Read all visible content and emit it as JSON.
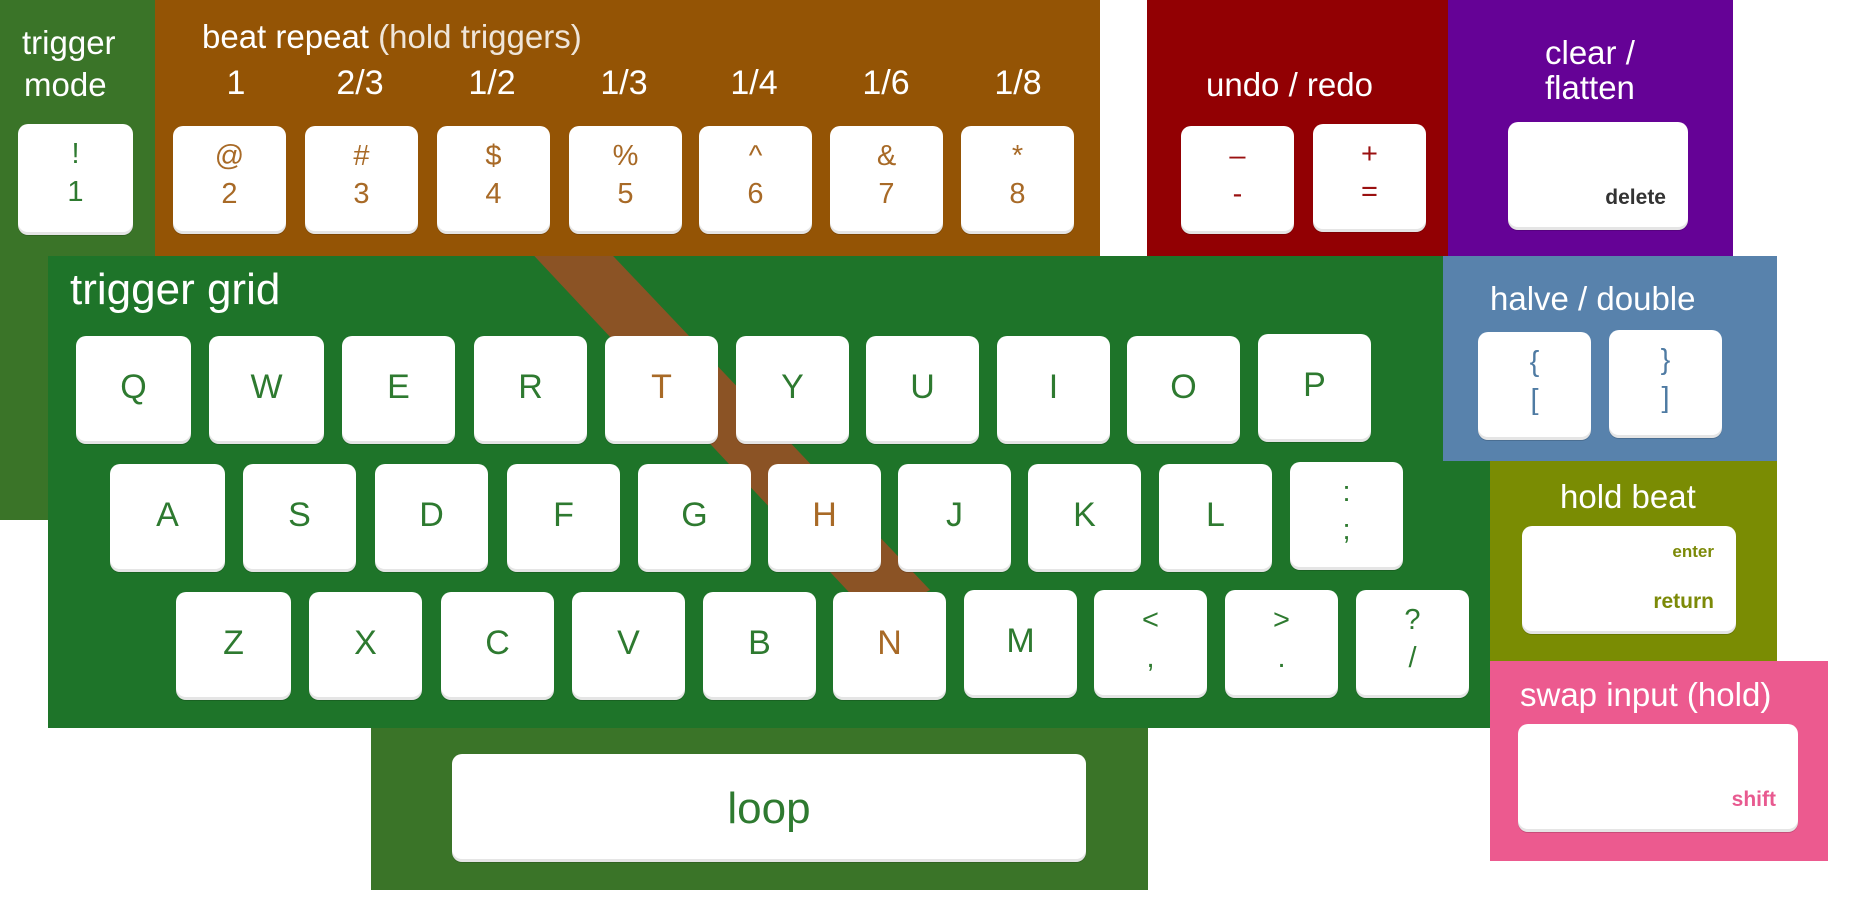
{
  "colors": {
    "trigger_grid_green": "#1e7429",
    "trigger_mode_green": "#3a7428",
    "beat_repeat_brown": "#945405",
    "diagonal_brown": "#8b5325",
    "undo_red": "#920003",
    "clear_purple": "#650296",
    "halve_blue": "#5882ac",
    "hold_beat_olive": "#7a8c03",
    "swap_pink": "#ec5a8f",
    "loop_green": "#3a7428",
    "key_white": "#ffffff"
  },
  "trigger_mode": {
    "title_line1": "trigger",
    "title_line2": "mode",
    "key": {
      "top": "!",
      "bottom": "1"
    }
  },
  "beat_repeat": {
    "title": "beat repeat",
    "subtitle": "(hold triggers)",
    "fractions": [
      "1",
      "2/3",
      "1/2",
      "1/3",
      "1/4",
      "1/6",
      "1/8"
    ],
    "keys": [
      {
        "top": "@",
        "bottom": "2"
      },
      {
        "top": "#",
        "bottom": "3"
      },
      {
        "top": "$",
        "bottom": "4"
      },
      {
        "top": "%",
        "bottom": "5"
      },
      {
        "top": "^",
        "bottom": "6"
      },
      {
        "top": "&",
        "bottom": "7"
      },
      {
        "top": "*",
        "bottom": "8"
      }
    ]
  },
  "undo_redo": {
    "title": "undo / redo",
    "keys": [
      {
        "top": "–",
        "bottom": "-"
      },
      {
        "top": "+",
        "bottom": "="
      }
    ]
  },
  "clear_flatten": {
    "title_line1": "clear /",
    "title_line2": "flatten",
    "key_label": "delete"
  },
  "trigger_grid": {
    "title": "trigger grid",
    "row1": [
      "Q",
      "W",
      "E",
      "R",
      "T",
      "Y",
      "U",
      "I",
      "O",
      "P"
    ],
    "row2": [
      "A",
      "S",
      "D",
      "F",
      "G",
      "H",
      "J",
      "K",
      "L"
    ],
    "row2_last": {
      "top": ":",
      "bottom": ";"
    },
    "row3": [
      "Z",
      "X",
      "C",
      "V",
      "B",
      "N",
      "M"
    ],
    "row3_sym": [
      {
        "top": "<",
        "bottom": ","
      },
      {
        "top": ">",
        "bottom": "."
      },
      {
        "top": "?",
        "bottom": "/"
      }
    ]
  },
  "halve_double": {
    "title": "halve / double",
    "keys": [
      {
        "top": "{",
        "bottom": "["
      },
      {
        "top": "}",
        "bottom": "]"
      }
    ]
  },
  "hold_beat": {
    "title": "hold beat",
    "key_top": "enter",
    "key_bottom": "return"
  },
  "swap_input": {
    "title": "swap input (hold)",
    "key_label": "shift"
  },
  "loop": {
    "label": "loop"
  }
}
